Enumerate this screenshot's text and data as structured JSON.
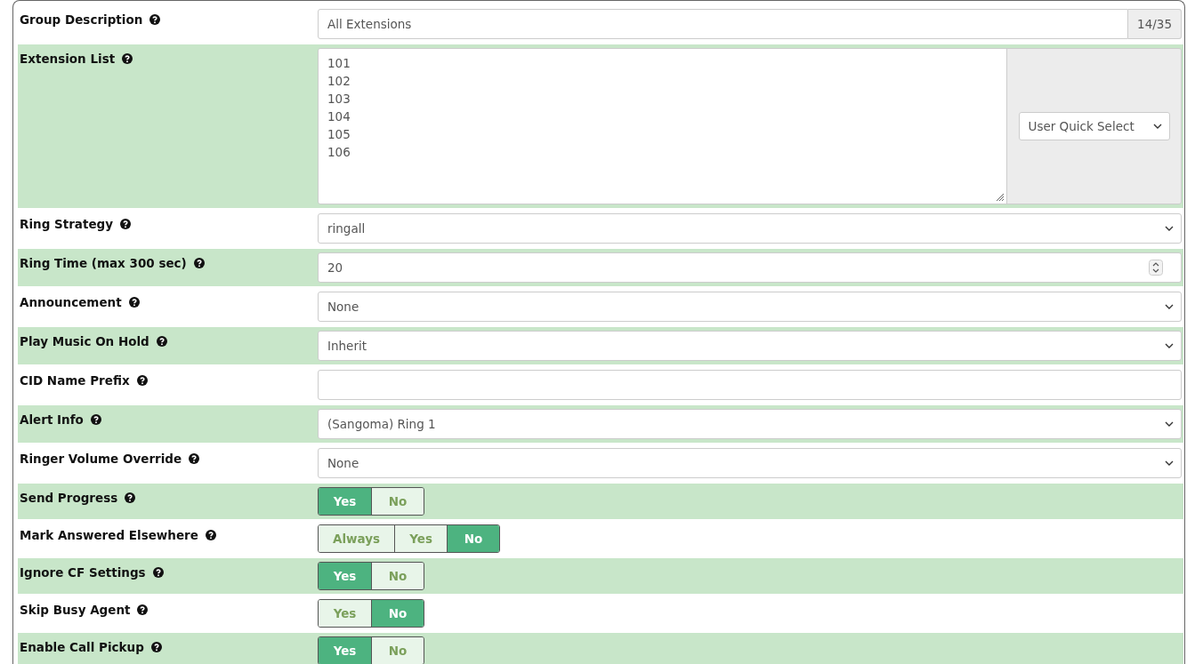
{
  "rows": [
    {
      "kind": "text",
      "label": "Group Description",
      "value": "All Extensions",
      "counter": "14/35"
    },
    {
      "kind": "textarea",
      "label": "Extension List",
      "lines": [
        "101",
        "102",
        "103",
        "104",
        "105",
        "106"
      ],
      "quick_select": "User Quick Select"
    },
    {
      "kind": "select",
      "label": "Ring Strategy",
      "value": "ringall"
    },
    {
      "kind": "number",
      "label": "Ring Time (max 300 sec)",
      "value": "20"
    },
    {
      "kind": "select",
      "label": "Announcement",
      "value": "None"
    },
    {
      "kind": "select",
      "label": "Play Music On Hold",
      "value": "Inherit"
    },
    {
      "kind": "text",
      "label": "CID Name Prefix"
    },
    {
      "kind": "select",
      "label": "Alert Info",
      "value": "(Sangoma) Ring 1"
    },
    {
      "kind": "select",
      "label": "Ringer Volume Override",
      "value": "None"
    },
    {
      "kind": "toggle",
      "label": "Send Progress",
      "options": [
        {
          "label": "Yes",
          "selected": true
        },
        {
          "label": "No",
          "selected": false
        }
      ]
    },
    {
      "kind": "toggle",
      "label": "Mark Answered Elsewhere",
      "options": [
        {
          "label": "Always",
          "selected": false
        },
        {
          "label": "Yes",
          "selected": false
        },
        {
          "label": "No",
          "selected": true
        }
      ]
    },
    {
      "kind": "toggle",
      "label": "Ignore CF Settings",
      "options": [
        {
          "label": "Yes",
          "selected": true
        },
        {
          "label": "No",
          "selected": false
        }
      ]
    },
    {
      "kind": "toggle",
      "label": "Skip Busy Agent",
      "options": [
        {
          "label": "Yes",
          "selected": false
        },
        {
          "label": "No",
          "selected": true
        }
      ]
    },
    {
      "kind": "toggle",
      "label": "Enable Call Pickup",
      "options": [
        {
          "label": "Yes",
          "selected": true
        },
        {
          "label": "No",
          "selected": false
        }
      ]
    }
  ]
}
